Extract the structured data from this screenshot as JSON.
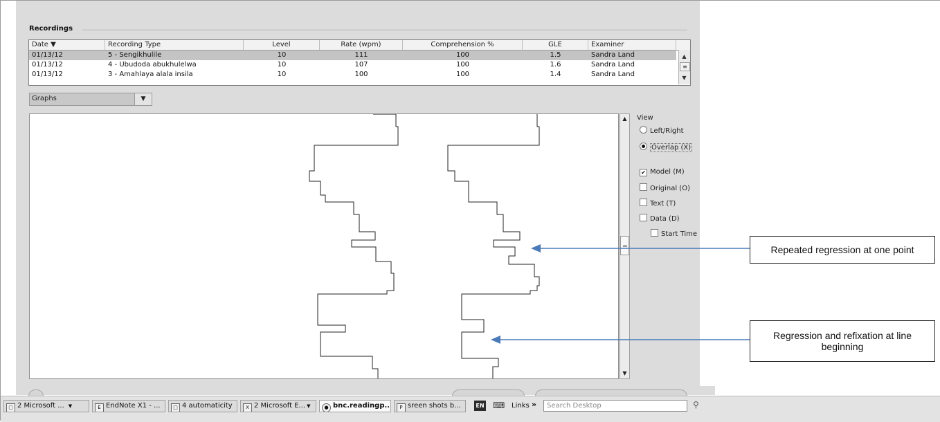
{
  "recordings": {
    "title": "Recordings",
    "columns": [
      {
        "label": "Date ▼"
      },
      {
        "label": "Recording Type"
      },
      {
        "label": "Level"
      },
      {
        "label": "Rate (wpm)"
      },
      {
        "label": "Comprehension %"
      },
      {
        "label": "GLE"
      },
      {
        "label": "Examiner"
      }
    ],
    "rows": [
      {
        "date": "01/13/12",
        "type": "5 - Sengikhulile",
        "level": "10",
        "rate": "111",
        "comprehension": "100",
        "gle": "1.5",
        "examiner": "Sandra Land",
        "selected": true
      },
      {
        "date": "01/13/12",
        "type": "4 - Ubudoda abukhulelwa",
        "level": "10",
        "rate": "107",
        "comprehension": "100",
        "gle": "1.6",
        "examiner": "Sandra Land",
        "selected": false
      },
      {
        "date": "01/13/12",
        "type": "3 - Amahlaya alala insila",
        "level": "10",
        "rate": "100",
        "comprehension": "100",
        "gle": "1.4",
        "examiner": "Sandra Land",
        "selected": false
      }
    ]
  },
  "graphs_select": {
    "value": "Graphs"
  },
  "view_panel": {
    "title": "View",
    "radios": [
      {
        "label": "Left/Right",
        "checked": false
      },
      {
        "label": "Overlap (X)",
        "checked": true
      }
    ],
    "checkboxes": [
      {
        "label": "Model (M)",
        "checked": true
      },
      {
        "label": "Original (O)",
        "checked": false
      },
      {
        "label": "Text (T)",
        "checked": false
      },
      {
        "label": "Data (D)",
        "checked": false
      },
      {
        "label": "Start Time",
        "checked": false
      }
    ]
  },
  "callouts": {
    "repeated": "Repeated regression at one point",
    "regression": "Regression and refixation at line beginning"
  },
  "taskbar": {
    "items": [
      {
        "label": "2 Microsoft ...",
        "icon": "window-icon",
        "has_menu": true
      },
      {
        "label": "EndNote X1 - ...",
        "icon": "endnote-icon",
        "has_menu": false
      },
      {
        "label": "4 automaticity",
        "icon": "folder-icon",
        "has_menu": false
      },
      {
        "label": "2 Microsoft E...",
        "icon": "excel-icon",
        "has_menu": true
      },
      {
        "label": "bnc.readingp...",
        "icon": "browser-icon",
        "has_menu": false,
        "active": true
      },
      {
        "label": "sreen shots b...",
        "icon": "powerpoint-icon",
        "has_menu": false
      }
    ],
    "language": "EN",
    "links": "Links",
    "search_placeholder": "Search Desktop"
  },
  "colors": {
    "panel": "#dcdcdc",
    "selected_row": "#c4c4c4",
    "arrow": "#4a7ab8",
    "trace": "#222222"
  }
}
